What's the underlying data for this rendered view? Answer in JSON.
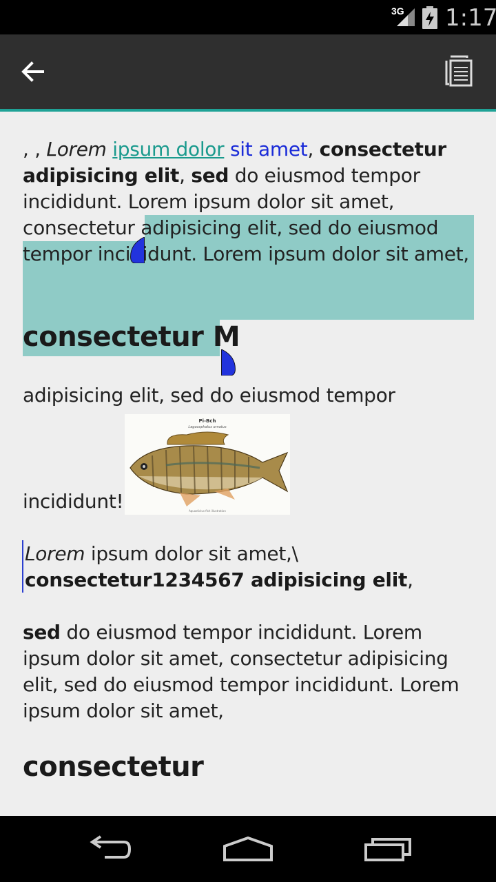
{
  "status_bar": {
    "network": "3G",
    "time": "1:17",
    "icons": [
      "signal-icon",
      "battery-charging-icon"
    ]
  },
  "action_bar": {
    "back_icon": "arrow-left-icon",
    "copy_icon": "copy-icon",
    "accent_color": "#1fa296"
  },
  "content": {
    "p1": {
      "lead": ", , ",
      "italic": "Lorem",
      "space": " ",
      "link_teal": "ipsum dolor",
      "link_blue": "sit amet",
      "comma": ", ",
      "bold1": "consectetur adipisicing elit",
      "comma2": ", ",
      "bold2": "sed",
      "rest": " do eiusmod tempor incididunt. Lorem ipsum dolor sit amet, consectetur adipisicing elit, sed do eiusmod tempor incididunt. Lorem ipsum dolor sit amet,"
    },
    "heading1": "consectetur M",
    "line_a": "adipisicing elit, sed do eiusmod tempor",
    "line_b": "incididunt!",
    "quote": {
      "italic": "Lorem",
      "text": " ipsum dolor sit amet,\\",
      "bold": "consectetur1234567 adipisicing elit",
      "tail": ","
    },
    "p3": {
      "bold": "sed",
      "rest": " do eiusmod tempor incididunt. Lorem ipsum dolor sit amet, consectetur adipisicing elit, sed do eiusmod tempor incididunt. Lorem ipsum dolor sit amet,"
    },
    "heading2": "consectetur",
    "image": {
      "title": "Pi-Bch",
      "subtitle": "Lagocephalus ornatus",
      "caption": "Aquasticlus fish illustration",
      "icon": "fish-image"
    },
    "selection_color": "#8fcbc6",
    "handle_color": "#2233dd"
  },
  "nav_bar": {
    "back": "nav-back-icon",
    "home": "nav-home-icon",
    "recents": "nav-recents-icon"
  }
}
